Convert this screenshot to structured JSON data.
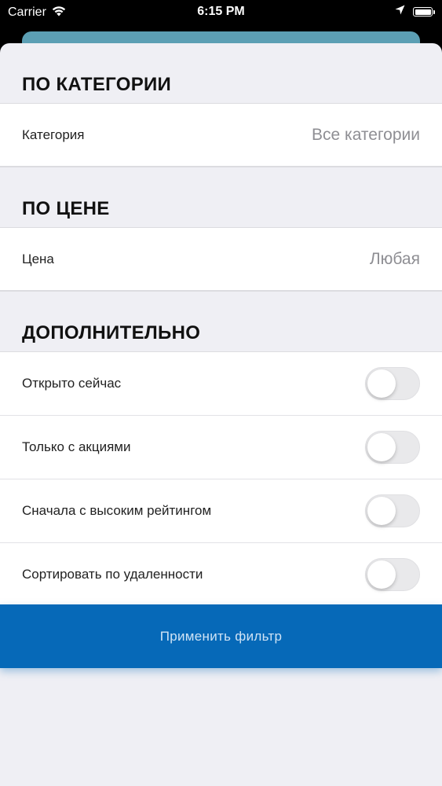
{
  "status_bar": {
    "carrier": "Carrier",
    "time": "6:15 PM"
  },
  "sections": {
    "category": {
      "header": "ПО КАТЕГОРИИ",
      "label": "Категория",
      "value": "Все категории"
    },
    "price": {
      "header": "ПО ЦЕНЕ",
      "label": "Цена",
      "value": "Любая"
    },
    "extra": {
      "header": "ДОПОЛНИТЕЛЬНО",
      "toggles": [
        {
          "label": "Открыто сейчас",
          "on": false
        },
        {
          "label": "Только с акциями",
          "on": false
        },
        {
          "label": "Сначала с высоким рейтингом",
          "on": false
        },
        {
          "label": "Сортировать по удаленности",
          "on": false
        }
      ]
    }
  },
  "apply_button": {
    "label": "Применить фильтр"
  },
  "colors": {
    "accent": "#0669b8",
    "sheet_bg": "#efeff4",
    "behind_card": "#5c9fb4"
  }
}
